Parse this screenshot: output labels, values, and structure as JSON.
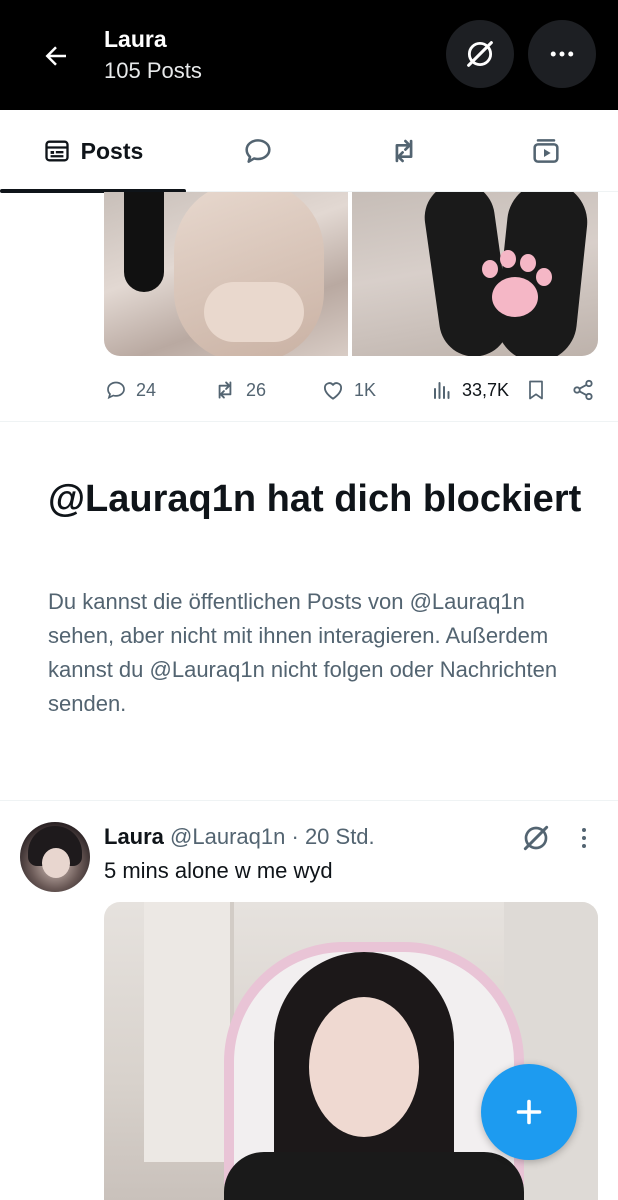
{
  "header": {
    "title": "Laura",
    "subtitle": "105 Posts",
    "back_icon": "arrow-left-icon",
    "grok_icon": "grok-slash-icon",
    "more_icon": "more-horizontal-icon"
  },
  "tabs": [
    {
      "label": "Posts",
      "icon": "posts-list-icon",
      "active": true
    },
    {
      "label": "",
      "icon": "replies-bubble-icon"
    },
    {
      "label": "",
      "icon": "repost-icon"
    },
    {
      "label": "",
      "icon": "media-play-icon"
    }
  ],
  "post1": {
    "replies": "24",
    "reposts": "26",
    "likes": "1K",
    "views": "33,7K"
  },
  "blocked": {
    "title": "@Lauraq1n hat dich blockiert",
    "text": "Du kannst die öffentlichen Posts von @Lauraq1n sehen, aber nicht mit ihnen interagieren. Außerdem kannst du @Lauraq1n nicht folgen oder Nachrichten senden."
  },
  "post2": {
    "name": "Laura",
    "handle": "@Lauraq1n",
    "separator": "·",
    "time": "20 Std.",
    "text": "5 mins alone w me wyd"
  },
  "colors": {
    "accent": "#1d9bf0",
    "text": "#0f1419",
    "muted": "#536471",
    "header_bg": "#000000"
  }
}
